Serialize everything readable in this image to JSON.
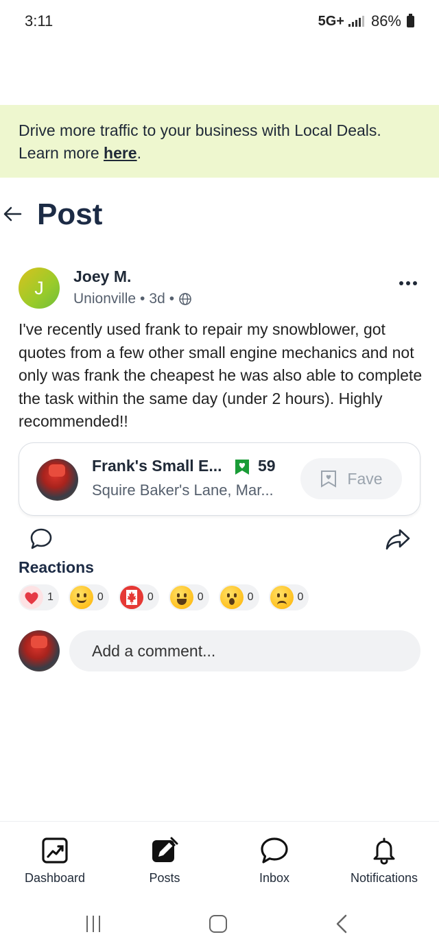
{
  "status_bar": {
    "time": "3:11",
    "network": "5G+",
    "battery": "86%"
  },
  "promo": {
    "text": "Drive more traffic to your business with Local Deals. Learn more ",
    "link": "here",
    "suffix": "."
  },
  "header": {
    "title": "Post"
  },
  "post": {
    "author_initial": "J",
    "author_name": "Joey M.",
    "location": "Unionville",
    "age": "3d",
    "body": "I've recently used frank to repair my snowblower, got quotes from a few other small engine mechanics and not only was frank the cheapest he was also able to complete the task within the same day (under 2 hours). Highly recommended!!"
  },
  "business": {
    "name": "Frank's Small E...",
    "fave_count": "59",
    "address": "Squire Baker's Lane, Mar...",
    "fave_label": "Fave"
  },
  "reactions": {
    "label": "Reactions",
    "items": [
      {
        "icon": "heart-icon",
        "count": "1"
      },
      {
        "icon": "smile-icon",
        "count": "0"
      },
      {
        "icon": "canada-icon",
        "count": "0"
      },
      {
        "icon": "grin-icon",
        "count": "0"
      },
      {
        "icon": "surprised-icon",
        "count": "0"
      },
      {
        "icon": "sad-icon",
        "count": "0"
      }
    ]
  },
  "comment": {
    "placeholder": "Add a comment..."
  },
  "bottom_nav": {
    "items": [
      {
        "label": "Dashboard",
        "icon": "dashboard-icon"
      },
      {
        "label": "Posts",
        "icon": "posts-icon"
      },
      {
        "label": "Inbox",
        "icon": "inbox-icon"
      },
      {
        "label": "Notifications",
        "icon": "bell-icon"
      }
    ]
  },
  "colors": {
    "promo_bg": "#eef7cf",
    "title": "#1c2b45",
    "badge_green": "#1a9c37"
  }
}
